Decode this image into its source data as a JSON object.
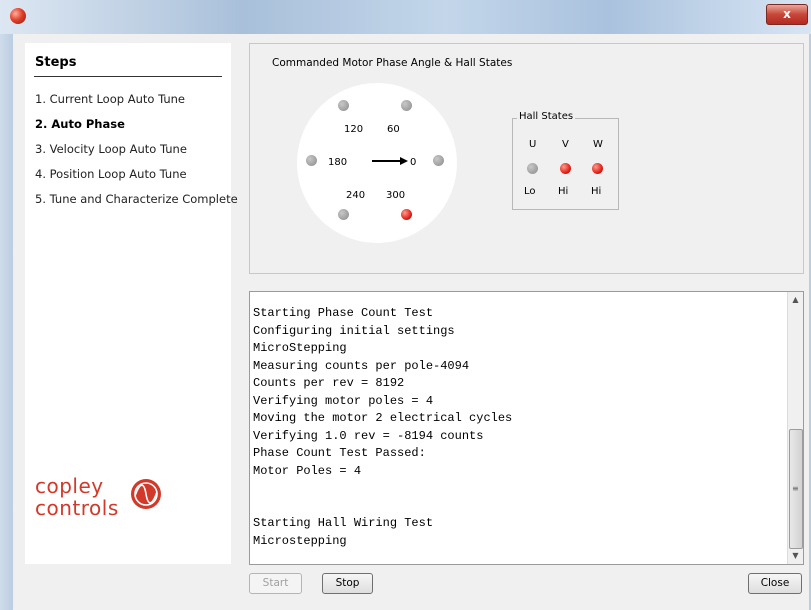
{
  "window": {
    "close_glyph": "x",
    "app_icon": "copley-app-icon"
  },
  "steps": {
    "title": "Steps",
    "items": [
      {
        "label": "1. Current Loop Auto Tune",
        "active": false
      },
      {
        "label": "2. Auto Phase",
        "active": true
      },
      {
        "label": "3. Velocity Loop Auto Tune",
        "active": false
      },
      {
        "label": "4. Position Loop Auto Tune",
        "active": false
      },
      {
        "label": "5. Tune and Characterize Complete",
        "active": false
      }
    ]
  },
  "logo": {
    "line1": "copley",
    "line2": "controls",
    "color": "#d2392a"
  },
  "phase_panel": {
    "title": "Commanded Motor Phase Angle & Hall States",
    "angle_labels": [
      "0",
      "60",
      "120",
      "180",
      "240",
      "300"
    ],
    "angle_indicators": [
      {
        "angle": "0",
        "state": "off"
      },
      {
        "angle": "60",
        "state": "off"
      },
      {
        "angle": "120",
        "state": "off"
      },
      {
        "angle": "180",
        "state": "off"
      },
      {
        "angle": "240",
        "state": "off"
      },
      {
        "angle": "300",
        "state": "on"
      }
    ],
    "commanded_angle_deg": 0
  },
  "hall_states": {
    "title": "Hall States",
    "sensors": [
      {
        "letter": "U",
        "state": "Lo"
      },
      {
        "letter": "V",
        "state": "Hi"
      },
      {
        "letter": "W",
        "state": "Hi"
      }
    ]
  },
  "log": {
    "lines": [
      "Starting Phase Count Test",
      "Configuring initial settings",
      "MicroStepping",
      "Measuring counts per pole-4094",
      "Counts per rev = 8192",
      "Verifying motor poles = 4",
      "Moving the motor 2 electrical cycles",
      "Verifying 1.0 rev = -8194 counts",
      "Phase Count Test Passed:",
      "Motor Poles = 4",
      "",
      "",
      "Starting Hall Wiring Test",
      "Microstepping"
    ]
  },
  "buttons": {
    "start": "Start",
    "stop": "Stop",
    "close": "Close"
  },
  "colors": {
    "indicator_on": "#e0221a",
    "indicator_off": "#8a8a8a",
    "window_bg": "#f0f0f0"
  }
}
